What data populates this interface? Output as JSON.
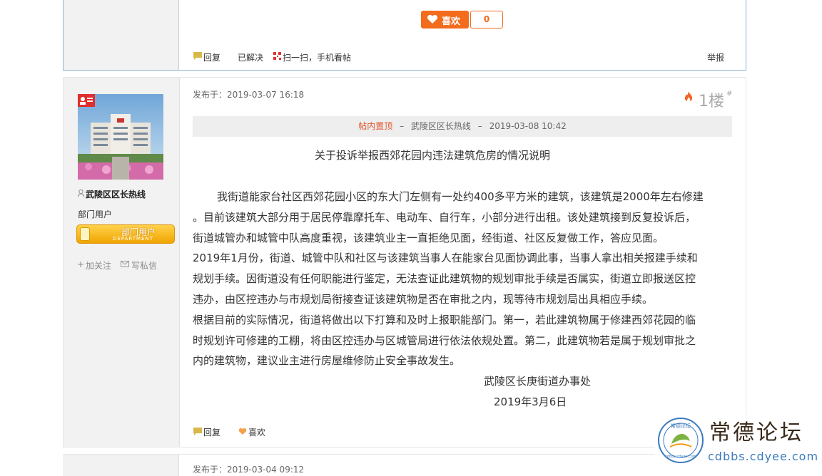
{
  "top_post": {
    "like_label": "喜欢",
    "like_count": "0",
    "actions": {
      "reply": "回复",
      "solved": "已解决",
      "scan": "扫一扫，手机看帖",
      "report": "举报"
    }
  },
  "post": {
    "published": "发布于：2019-03-07 16:18",
    "floor": "1楼",
    "floor_mark": "#",
    "bar": {
      "pin": "帖内置顶",
      "sep1": "–",
      "by": "武陵区区长热线",
      "sep2": "–",
      "time": "2019-03-08 10:42"
    },
    "user": {
      "name": "武陵区区长热线",
      "group": "部门用户",
      "badge_cn": "部门用户",
      "badge_en": "DEPARTMENT",
      "follow": "加关注",
      "message": "写私信"
    },
    "title": "关于投诉举报西郊花园内违法建筑危房的情况说明",
    "lines": [
      "我街道能家台社区西郊花园小区的东大门左侧有一处约400多平方米的建筑，该建筑是2000年左右修建",
      "。目前该建筑大部分用于居民停靠摩托车、电动车、自行车，小部分进行出租。该处建筑接到反复投诉后，",
      "街道城管办和城管中队高度重视，该建筑业主一直拒绝见面，经街道、社区反复做工作，答应见面。",
      "2019年1月份，街道、城管中队和社区与该建筑当事人在能家台见面协调此事，当事人拿出相关报建手续和",
      "规划手续。因街道没有任何职能进行鉴定，无法查证此建筑物的规划审批手续是否属实，街道立即报送区控",
      "违办，由区控违办与市规划局衔接查证该建筑物是否在审批之内，现等待市规划局出具相应手续。",
      "根据目前的实际情况，街道将做出以下打算和及时上报职能部门。第一，若此建筑物属于修建西郊花园的临",
      "时规划许可修建的工棚，将由区控违办与区城管局进行依法依规处置。第二，此建筑物若是属于规划审批之",
      "内的建筑物，建议业主进行房屋维修防止安全事故发生。"
    ],
    "sign_org": "武陵区长庚街道办事处",
    "sign_date": "2019年3月6日",
    "actions": {
      "reply": "回复",
      "like": "喜欢"
    }
  },
  "next_post": {
    "published": "发布于：2019-03-04 09:12"
  },
  "watermark": {
    "title": "常德论坛",
    "url": "cdbbs.cdyee.com",
    "seal_text": "常德论坛",
    "seal_url": "cdbbs.cdyee.com"
  },
  "colors": {
    "accent": "#f36b1c",
    "link_red": "#e4572e",
    "border_blue": "#8fb0d4"
  }
}
